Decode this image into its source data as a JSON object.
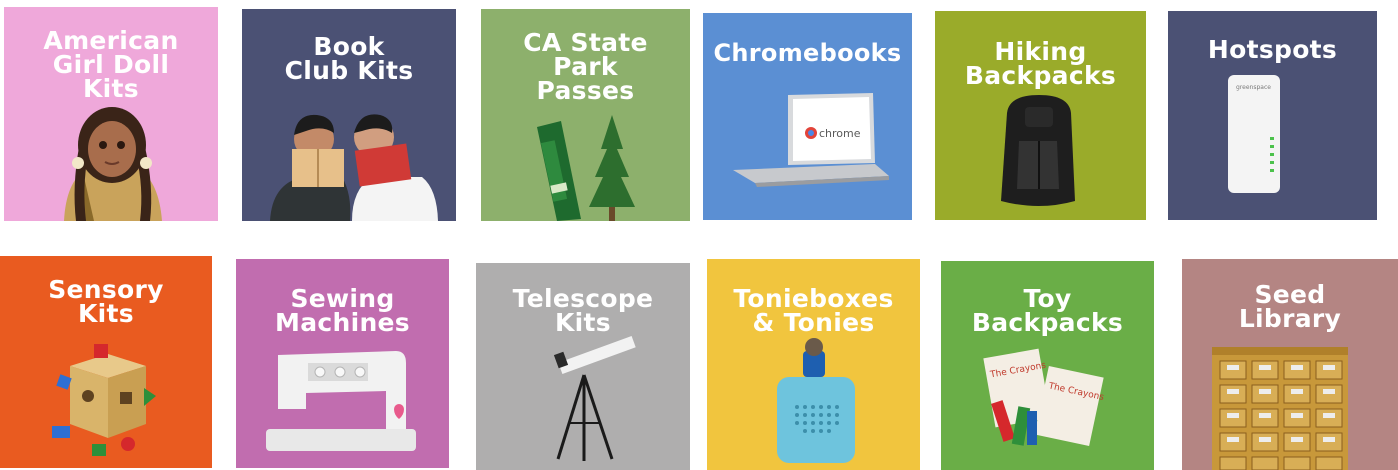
{
  "tiles": [
    {
      "id": "american-girl",
      "title": "American\nGirl Doll\nKits",
      "color": "#EFA8DA"
    },
    {
      "id": "book-club",
      "title": "Book\nClub Kits",
      "color": "#4B5174"
    },
    {
      "id": "ca-state-park",
      "title": "CA State\nPark\nPasses",
      "color": "#8DB06C"
    },
    {
      "id": "chromebooks",
      "title": "Chromebooks",
      "color": "#5B8FD3",
      "screen_text": "chrome"
    },
    {
      "id": "hiking",
      "title": "Hiking\nBackpacks",
      "color": "#9AAB2A"
    },
    {
      "id": "hotspots",
      "title": "Hotspots",
      "color": "#4B5174",
      "brand_text": "greenspace"
    },
    {
      "id": "sensory",
      "title": "Sensory\nKits",
      "color": "#E95B20"
    },
    {
      "id": "sewing",
      "title": "Sewing\nMachines",
      "color": "#C16DAF"
    },
    {
      "id": "telescope",
      "title": "Telescope\nKits",
      "color": "#AFAEAE"
    },
    {
      "id": "tonieboxes",
      "title": "Tonieboxes\n& Tonies",
      "color": "#F1C53E"
    },
    {
      "id": "toy-backpacks",
      "title": "Toy\nBackpacks",
      "color": "#6AAE47",
      "book_text": "The Crayons"
    },
    {
      "id": "seed-library",
      "title": "Seed\nLibrary",
      "color": "#B48583"
    }
  ]
}
